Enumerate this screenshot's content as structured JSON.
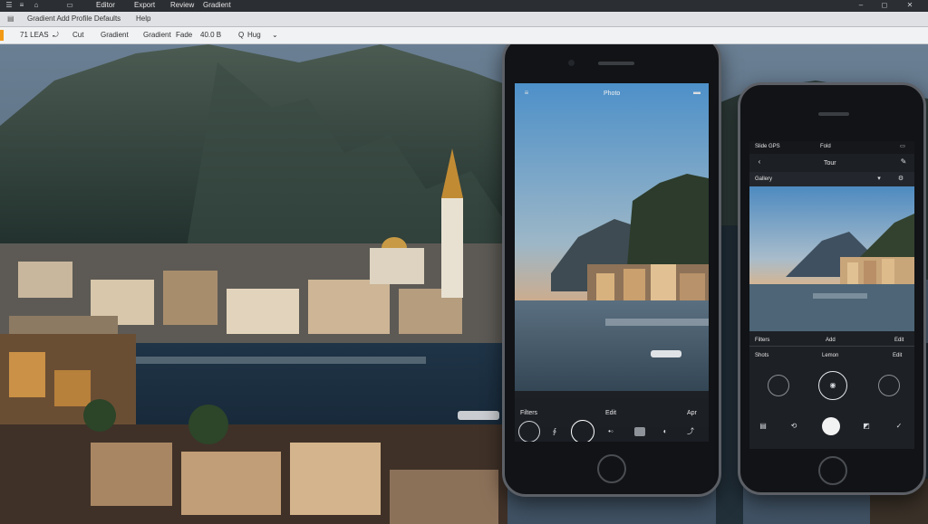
{
  "window": {
    "menu_items": [
      "Editor",
      "Export",
      "Review",
      "Gradient"
    ],
    "title_right_icons": [
      "minimize-icon",
      "maximize-icon",
      "close-icon"
    ]
  },
  "toolbar": {
    "tab_label": "Gradient Add Profile Defaults",
    "tab_label2": "Help"
  },
  "options_bar": {
    "items": [
      "71 LEAS",
      "Cut",
      "Gradient",
      "Gradient",
      "Fade",
      "40.0 B",
      "Hug"
    ]
  },
  "phone1": {
    "title": "Photo",
    "bottom_labels": {
      "left": "Filters",
      "center": "Edit",
      "right": "Apr"
    }
  },
  "phone2": {
    "status_left": "Slide GPS",
    "status_center": "Fold",
    "title": "Tour",
    "row_label": "Gallery",
    "bottom_left": "Filters",
    "bottom_center": "Add",
    "bottom_right": "Edit",
    "row2_left": "Shots",
    "row2_center": "Lemon",
    "row2_right": "Edit"
  },
  "colors": {
    "accent_orange": "#f29a15",
    "chrome_dark": "#2b2e33",
    "toolbar_gray": "#dfe1e4"
  }
}
